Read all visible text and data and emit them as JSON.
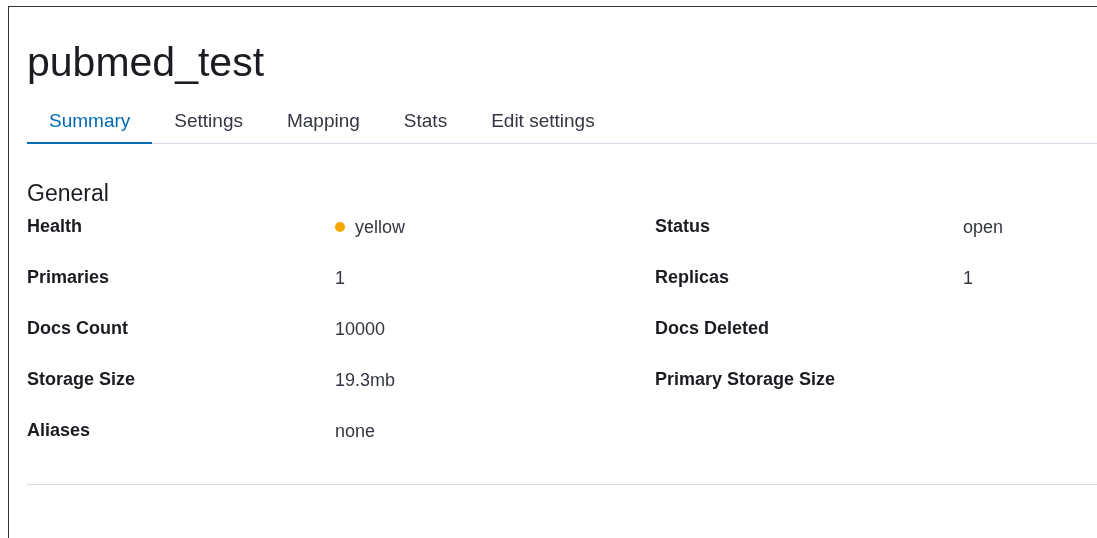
{
  "title": "pubmed_test",
  "tabs": [
    {
      "label": "Summary",
      "selected": true
    },
    {
      "label": "Settings",
      "selected": false
    },
    {
      "label": "Mapping",
      "selected": false
    },
    {
      "label": "Stats",
      "selected": false
    },
    {
      "label": "Edit settings",
      "selected": false
    }
  ],
  "section": {
    "title": "General",
    "rows": [
      {
        "left": {
          "label": "Health",
          "value": "yellow",
          "color": "#f5a700"
        },
        "right": {
          "label": "Status",
          "value": "open"
        }
      },
      {
        "left": {
          "label": "Primaries",
          "value": "1"
        },
        "right": {
          "label": "Replicas",
          "value": "1"
        }
      },
      {
        "left": {
          "label": "Docs Count",
          "value": "10000"
        },
        "right": {
          "label": "Docs Deleted"
        }
      },
      {
        "left": {
          "label": "Storage Size",
          "value": "19.3mb"
        },
        "right": {
          "label": "Primary Storage Size"
        }
      },
      {
        "left": {
          "label": "Aliases",
          "value": "none"
        }
      }
    ]
  }
}
